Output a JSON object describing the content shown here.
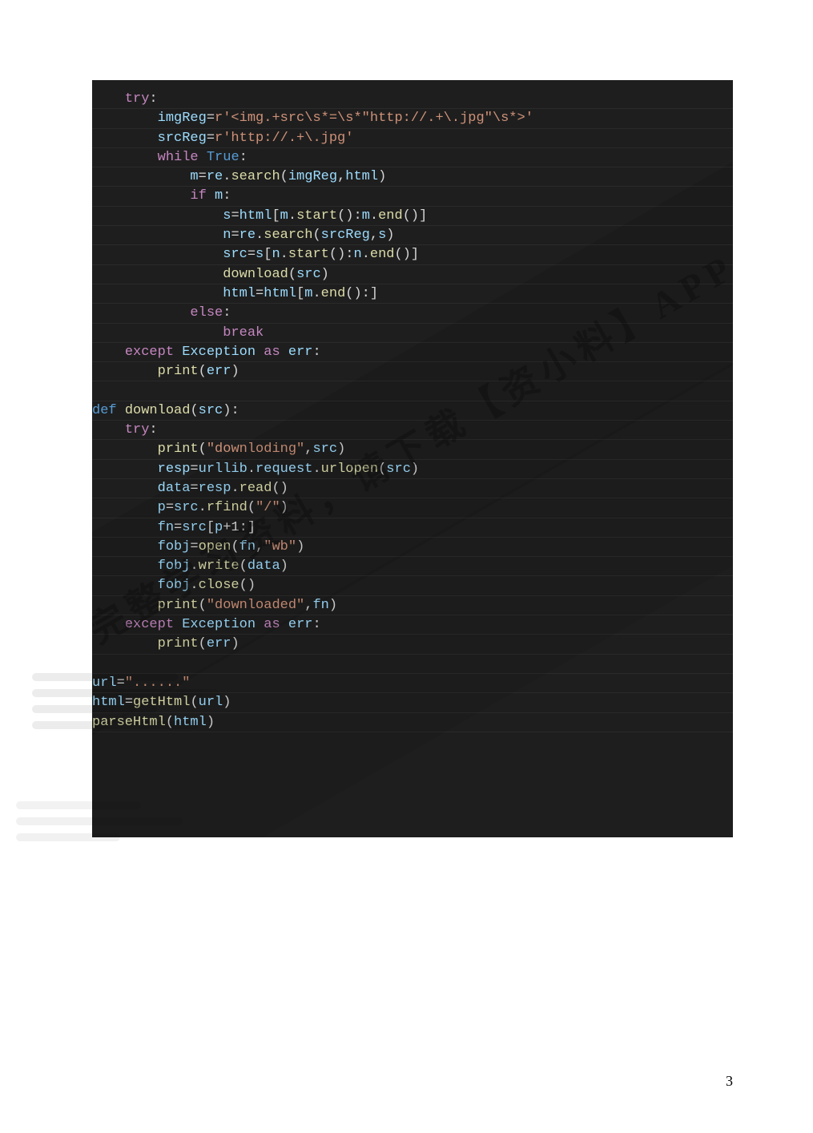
{
  "code": {
    "lines": [
      [
        [
          "    ",
          ""
        ],
        [
          "try",
          "kw"
        ],
        [
          ":",
          "plain"
        ]
      ],
      [
        [
          "        imgReg",
          "var"
        ],
        [
          "=",
          "op"
        ],
        [
          "r",
          "str"
        ],
        [
          "'<img.+src\\s*=\\s*\"http://.+\\.jpg\"\\s*>'",
          "str"
        ]
      ],
      [
        [
          "        srcReg",
          "var"
        ],
        [
          "=",
          "op"
        ],
        [
          "r",
          "str"
        ],
        [
          "'http://.+\\.jpg'",
          "str"
        ]
      ],
      [
        [
          "        ",
          "plain"
        ],
        [
          "while",
          "kw"
        ],
        [
          " ",
          "plain"
        ],
        [
          "True",
          "bool"
        ],
        [
          ":",
          "plain"
        ]
      ],
      [
        [
          "            m",
          "var"
        ],
        [
          "=",
          "op"
        ],
        [
          "re",
          "var"
        ],
        [
          ".",
          "op"
        ],
        [
          "search",
          "fn"
        ],
        [
          "(",
          "op"
        ],
        [
          "imgReg",
          "var"
        ],
        [
          ",",
          "op"
        ],
        [
          "html",
          "var"
        ],
        [
          ")",
          "op"
        ]
      ],
      [
        [
          "            ",
          "plain"
        ],
        [
          "if",
          "kw"
        ],
        [
          " ",
          "plain"
        ],
        [
          "m",
          "var"
        ],
        [
          ":",
          "plain"
        ]
      ],
      [
        [
          "                s",
          "var"
        ],
        [
          "=",
          "op"
        ],
        [
          "html",
          "var"
        ],
        [
          "[",
          "op"
        ],
        [
          "m",
          "var"
        ],
        [
          ".",
          "op"
        ],
        [
          "start",
          "fn"
        ],
        [
          "():",
          "op"
        ],
        [
          "m",
          "var"
        ],
        [
          ".",
          "op"
        ],
        [
          "end",
          "fn"
        ],
        [
          "()]",
          "op"
        ]
      ],
      [
        [
          "                n",
          "var"
        ],
        [
          "=",
          "op"
        ],
        [
          "re",
          "var"
        ],
        [
          ".",
          "op"
        ],
        [
          "search",
          "fn"
        ],
        [
          "(",
          "op"
        ],
        [
          "srcReg",
          "var"
        ],
        [
          ",",
          "op"
        ],
        [
          "s",
          "var"
        ],
        [
          ")",
          "op"
        ]
      ],
      [
        [
          "                src",
          "var"
        ],
        [
          "=",
          "op"
        ],
        [
          "s",
          "var"
        ],
        [
          "[",
          "op"
        ],
        [
          "n",
          "var"
        ],
        [
          ".",
          "op"
        ],
        [
          "start",
          "fn"
        ],
        [
          "():",
          "op"
        ],
        [
          "n",
          "var"
        ],
        [
          ".",
          "op"
        ],
        [
          "end",
          "fn"
        ],
        [
          "()]",
          "op"
        ]
      ],
      [
        [
          "                ",
          "plain"
        ],
        [
          "download",
          "fn"
        ],
        [
          "(",
          "op"
        ],
        [
          "src",
          "var"
        ],
        [
          ")",
          "op"
        ]
      ],
      [
        [
          "                html",
          "var"
        ],
        [
          "=",
          "op"
        ],
        [
          "html",
          "var"
        ],
        [
          "[",
          "op"
        ],
        [
          "m",
          "var"
        ],
        [
          ".",
          "op"
        ],
        [
          "end",
          "fn"
        ],
        [
          "():]",
          "op"
        ]
      ],
      [
        [
          "            ",
          "plain"
        ],
        [
          "else",
          "kw"
        ],
        [
          ":",
          "plain"
        ]
      ],
      [
        [
          "                ",
          "plain"
        ],
        [
          "break",
          "kw"
        ]
      ],
      [
        [
          "    ",
          "plain"
        ],
        [
          "except",
          "kw"
        ],
        [
          " ",
          "plain"
        ],
        [
          "Exception",
          "var"
        ],
        [
          " ",
          "plain"
        ],
        [
          "as",
          "kw"
        ],
        [
          " ",
          "plain"
        ],
        [
          "err",
          "var"
        ],
        [
          ":",
          "plain"
        ]
      ],
      [
        [
          "        ",
          "plain"
        ],
        [
          "print",
          "fn"
        ],
        [
          "(",
          "op"
        ],
        [
          "err",
          "var"
        ],
        [
          ")",
          "op"
        ]
      ],
      [
        [
          " ",
          "plain"
        ]
      ],
      [
        [
          "def",
          "def"
        ],
        [
          " ",
          "plain"
        ],
        [
          "download",
          "fn"
        ],
        [
          "(",
          "op"
        ],
        [
          "src",
          "var"
        ],
        [
          "):",
          "op"
        ]
      ],
      [
        [
          "    ",
          "plain"
        ],
        [
          "try",
          "kw"
        ],
        [
          ":",
          "plain"
        ]
      ],
      [
        [
          "        ",
          "plain"
        ],
        [
          "print",
          "fn"
        ],
        [
          "(",
          "op"
        ],
        [
          "\"downloding\"",
          "str"
        ],
        [
          ",",
          "op"
        ],
        [
          "src",
          "var"
        ],
        [
          ")",
          "op"
        ]
      ],
      [
        [
          "        resp",
          "var"
        ],
        [
          "=",
          "op"
        ],
        [
          "urllib",
          "var"
        ],
        [
          ".",
          "op"
        ],
        [
          "request",
          "var"
        ],
        [
          ".",
          "op"
        ],
        [
          "urlopen",
          "fn"
        ],
        [
          "(",
          "op"
        ],
        [
          "src",
          "var"
        ],
        [
          ")",
          "op"
        ]
      ],
      [
        [
          "        data",
          "var"
        ],
        [
          "=",
          "op"
        ],
        [
          "resp",
          "var"
        ],
        [
          ".",
          "op"
        ],
        [
          "read",
          "fn"
        ],
        [
          "()",
          "op"
        ]
      ],
      [
        [
          "        p",
          "var"
        ],
        [
          "=",
          "op"
        ],
        [
          "src",
          "var"
        ],
        [
          ".",
          "op"
        ],
        [
          "rfind",
          "fn"
        ],
        [
          "(",
          "op"
        ],
        [
          "\"/\"",
          "str"
        ],
        [
          ")",
          "op"
        ]
      ],
      [
        [
          "        fn",
          "var"
        ],
        [
          "=",
          "op"
        ],
        [
          "src",
          "var"
        ],
        [
          "[",
          "op"
        ],
        [
          "p",
          "var"
        ],
        [
          "+",
          "op"
        ],
        [
          "1",
          "plain"
        ],
        [
          ":]",
          "op"
        ]
      ],
      [
        [
          "        fobj",
          "var"
        ],
        [
          "=",
          "op"
        ],
        [
          "open",
          "fn"
        ],
        [
          "(",
          "op"
        ],
        [
          "fn",
          "var"
        ],
        [
          ",",
          "op"
        ],
        [
          "\"wb\"",
          "str"
        ],
        [
          ")",
          "op"
        ]
      ],
      [
        [
          "        fobj",
          "var"
        ],
        [
          ".",
          "op"
        ],
        [
          "write",
          "fn"
        ],
        [
          "(",
          "op"
        ],
        [
          "data",
          "var"
        ],
        [
          ")",
          "op"
        ]
      ],
      [
        [
          "        fobj",
          "var"
        ],
        [
          ".",
          "op"
        ],
        [
          "close",
          "fn"
        ],
        [
          "()",
          "op"
        ]
      ],
      [
        [
          "        ",
          "plain"
        ],
        [
          "print",
          "fn"
        ],
        [
          "(",
          "op"
        ],
        [
          "\"downloaded\"",
          "str"
        ],
        [
          ",",
          "op"
        ],
        [
          "fn",
          "var"
        ],
        [
          ")",
          "op"
        ]
      ],
      [
        [
          "    ",
          "plain"
        ],
        [
          "except",
          "kw"
        ],
        [
          " ",
          "plain"
        ],
        [
          "Exception",
          "var"
        ],
        [
          " ",
          "plain"
        ],
        [
          "as",
          "kw"
        ],
        [
          " ",
          "plain"
        ],
        [
          "err",
          "var"
        ],
        [
          ":",
          "plain"
        ]
      ],
      [
        [
          "        ",
          "plain"
        ],
        [
          "print",
          "fn"
        ],
        [
          "(",
          "op"
        ],
        [
          "err",
          "var"
        ],
        [
          ")",
          "op"
        ]
      ],
      [
        [
          " ",
          "plain"
        ]
      ],
      [
        [
          "url",
          "var"
        ],
        [
          "=",
          "op"
        ],
        [
          "\"......\"",
          "str"
        ]
      ],
      [
        [
          "html",
          "var"
        ],
        [
          "=",
          "op"
        ],
        [
          "getHtml",
          "fn"
        ],
        [
          "(",
          "op"
        ],
        [
          "url",
          "var"
        ],
        [
          ")",
          "op"
        ]
      ],
      [
        [
          "parseHtml",
          "fn"
        ],
        [
          "(",
          "op"
        ],
        [
          "html",
          "var"
        ],
        [
          ")",
          "op"
        ]
      ]
    ]
  },
  "watermark": {
    "text": "完整学习资料，请下载【资小料】APP"
  },
  "page_number": "3"
}
